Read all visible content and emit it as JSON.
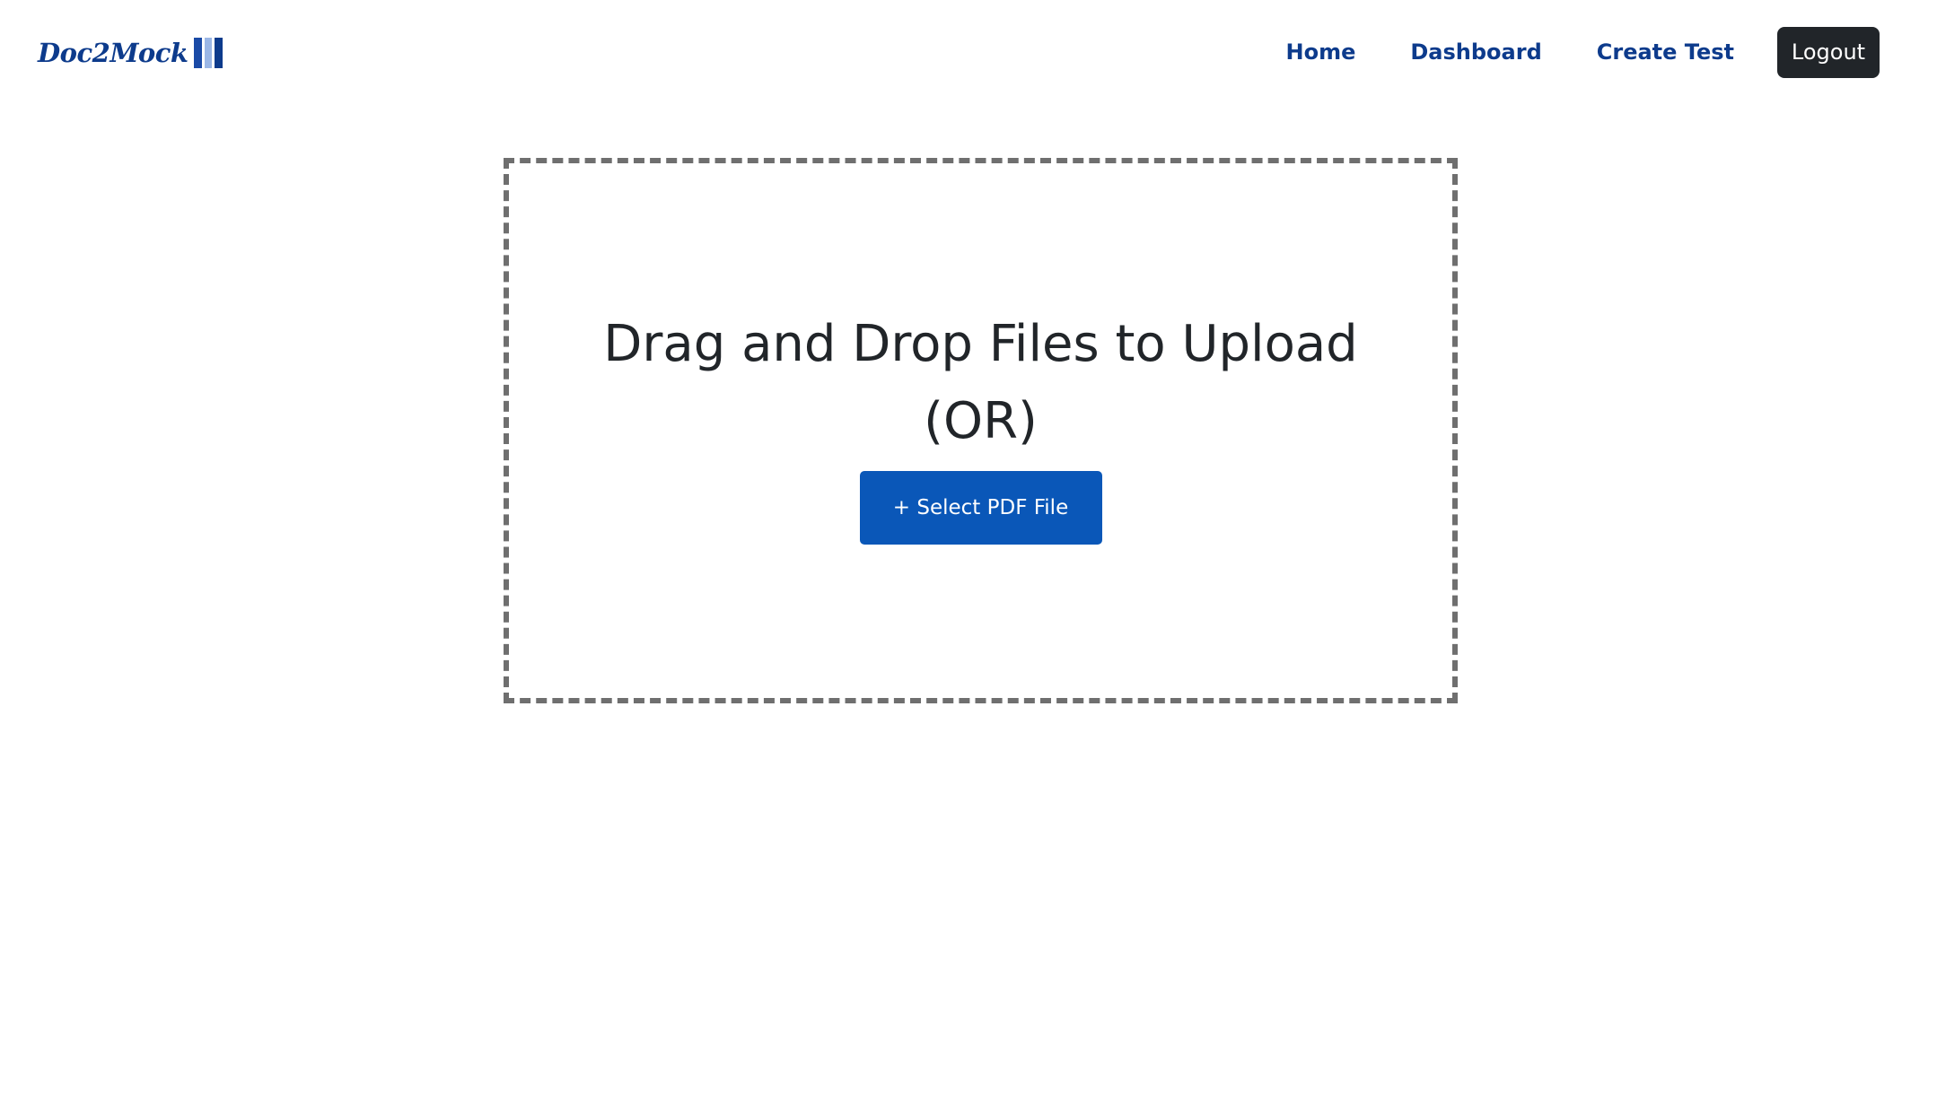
{
  "brand": {
    "name": "Doc2Mock",
    "logo_icon": "book-stripes-icon",
    "color": "#0d3b8c"
  },
  "nav": {
    "links": [
      {
        "label": "Home"
      },
      {
        "label": "Dashboard"
      },
      {
        "label": "Create Test"
      }
    ],
    "logout_label": "Logout"
  },
  "upload": {
    "heading_line1": "Drag and Drop Files to Upload",
    "heading_line2": "(OR)",
    "select_button_label": "+ Select PDF File",
    "button_color": "#0a57b8"
  }
}
